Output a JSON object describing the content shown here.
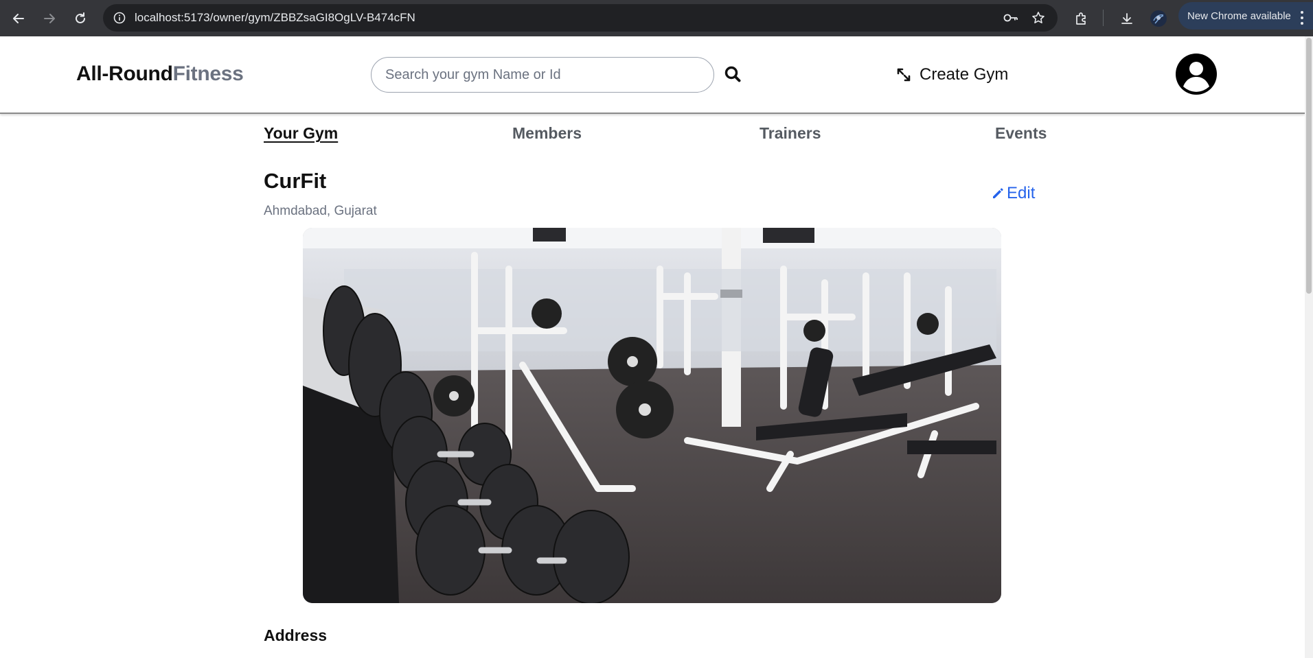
{
  "browser": {
    "url": "localhost:5173/owner/gym/ZBBZsaGI8OgLV-B474cFN",
    "update_label": "New Chrome available"
  },
  "header": {
    "brand_part1": "All-Round",
    "brand_part2": "Fitness",
    "search_placeholder": "Search your gym Name or Id",
    "create_gym_label": "Create Gym"
  },
  "tabs": [
    {
      "label": "Your Gym",
      "active": true
    },
    {
      "label": "Members",
      "active": false
    },
    {
      "label": "Trainers",
      "active": false
    },
    {
      "label": "Events",
      "active": false
    }
  ],
  "gym": {
    "name": "CurFit",
    "location": "Ahmdabad, Gujarat",
    "edit_label": "Edit",
    "address_heading": "Address"
  },
  "colors": {
    "brand_primary": "#111111",
    "brand_secondary": "#6b7280",
    "link": "#2563eb",
    "chrome_bg": "#35363a"
  }
}
